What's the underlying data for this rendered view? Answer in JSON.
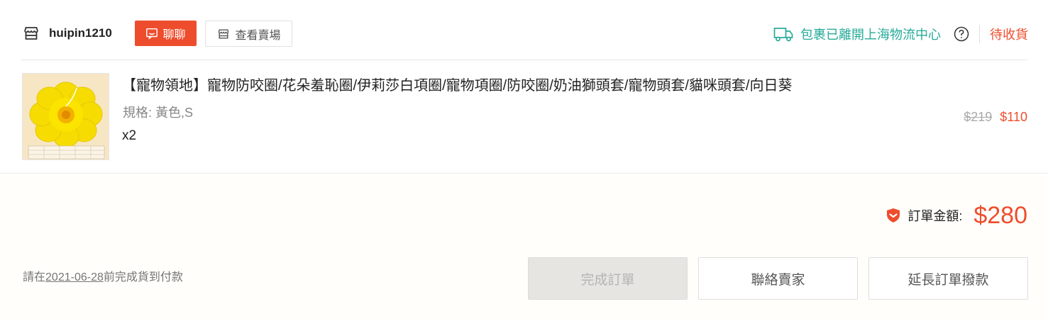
{
  "header": {
    "shop_name": "huipin1210",
    "chat_label": "聊聊",
    "view_shop_label": "查看賣場",
    "shipping_status": "包裹已離開上海物流中心",
    "order_status": "待收貨"
  },
  "product": {
    "title": "【寵物領地】寵物防咬圈/花朵羞恥圈/伊莉莎白項圈/寵物項圈/防咬圈/奶油獅頭套/寵物頭套/貓咪頭套/向日葵",
    "variation": "規格: 黃色,S",
    "quantity": "x2",
    "original_price": "$219",
    "price": "$110"
  },
  "footer": {
    "total_label": "訂單金額:",
    "total_amount": "$280",
    "payment_note_prefix": "請在",
    "payment_note_date": "2021-06-28",
    "payment_note_suffix": "前完成貨到付款",
    "buttons": {
      "complete": "完成訂單",
      "contact": "聯絡賣家",
      "extend": "延長訂單撥款"
    }
  },
  "colors": {
    "brand": "#ee4d2d",
    "shipping": "#26aa99",
    "product_yellow": "#f5dd00"
  },
  "icons": {
    "shop": "shop-icon",
    "chat": "chat-icon",
    "store": "store-icon",
    "truck": "truck-icon",
    "help": "help-icon",
    "shield": "shield-icon"
  }
}
